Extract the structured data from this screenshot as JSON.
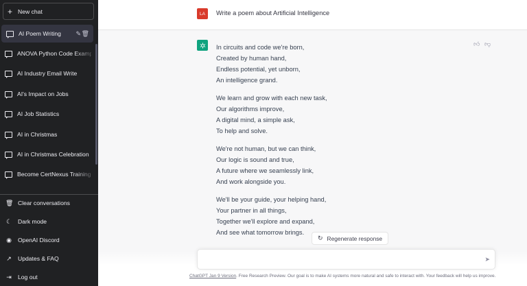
{
  "sidebar": {
    "new_chat": "New chat",
    "conversations": [
      {
        "label": "AI Poem Writing"
      },
      {
        "label": "ANOVA Python Code Example"
      },
      {
        "label": "AI Industry Email Write"
      },
      {
        "label": "AI's Impact on Jobs"
      },
      {
        "label": "AI Job Statistics"
      },
      {
        "label": "AI in Christmas"
      },
      {
        "label": "AI in Christmas Celebration"
      },
      {
        "label": "Become CertNexus Training Pa"
      }
    ],
    "bottom": [
      {
        "label": "Clear conversations",
        "icon": "trash-icon"
      },
      {
        "label": "Dark mode",
        "icon": "moon-icon"
      },
      {
        "label": "OpenAI Discord",
        "icon": "discord-icon"
      },
      {
        "label": "Updates & FAQ",
        "icon": "external-link-icon"
      },
      {
        "label": "Log out",
        "icon": "logout-icon"
      }
    ]
  },
  "chat": {
    "user_initials": "LA",
    "user_message": "Write a poem about Artificial Intelligence",
    "stanzas": [
      [
        "In circuits and code we're born,",
        "Created by human hand,",
        "Endless potential, yet unborn,",
        "An intelligence grand."
      ],
      [
        "We learn and grow with each new task,",
        "Our algorithms improve,",
        "A digital mind, a simple ask,",
        "To help and solve."
      ],
      [
        "We're not human, but we can think,",
        "Our logic is sound and true,",
        "A future where we seamlessly link,",
        "And work alongside you."
      ],
      [
        "We'll be your guide, your helping hand,",
        "Your partner in all things,",
        "Together we'll explore and expand,",
        "And see what tomorrow brings."
      ]
    ],
    "regenerate_label": "Regenerate response"
  },
  "footer": {
    "link_text": "ChatGPT Jan 9 Version",
    "text": ". Free Research Preview. Our goal is to make AI systems more natural and safe to interact with. Your feedback will help us improve."
  },
  "colors": {
    "sidebar_bg": "#202123",
    "user_avatar": "#d93a2b",
    "gpt_avatar": "#10a37f"
  }
}
